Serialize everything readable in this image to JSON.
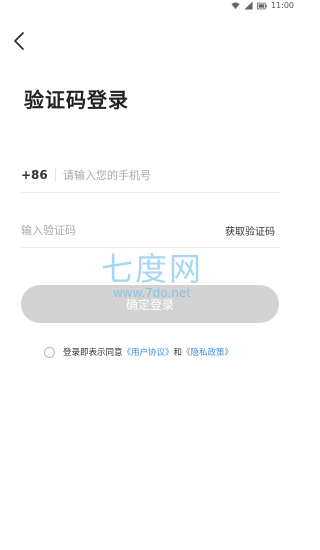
{
  "status_bar": {
    "time": "11:00",
    "wifi_icon": "wifi-icon",
    "signal_icon": "signal-icon",
    "battery_icon": "battery-icon"
  },
  "nav": {
    "back_icon": "chevron-left-icon"
  },
  "title": "验证码登录",
  "phone": {
    "country_code": "+86",
    "placeholder": "请输入您的手机号",
    "value": ""
  },
  "code": {
    "placeholder": "输入验证码",
    "value": "",
    "get_code_label": "获取验证码"
  },
  "confirm_button": {
    "label": "确定登录"
  },
  "agreement": {
    "prefix": "登录即表示同意",
    "user_agreement": "《用户协议》",
    "conjunction": "和",
    "privacy_policy": "《隐私政策》",
    "checked": false
  },
  "watermark": {
    "logo": "七度网",
    "url": "www.7do.net"
  },
  "colors": {
    "link": "#3b8bd8",
    "button_disabled": "#d3d3d3",
    "watermark": "#5fb6e8"
  }
}
